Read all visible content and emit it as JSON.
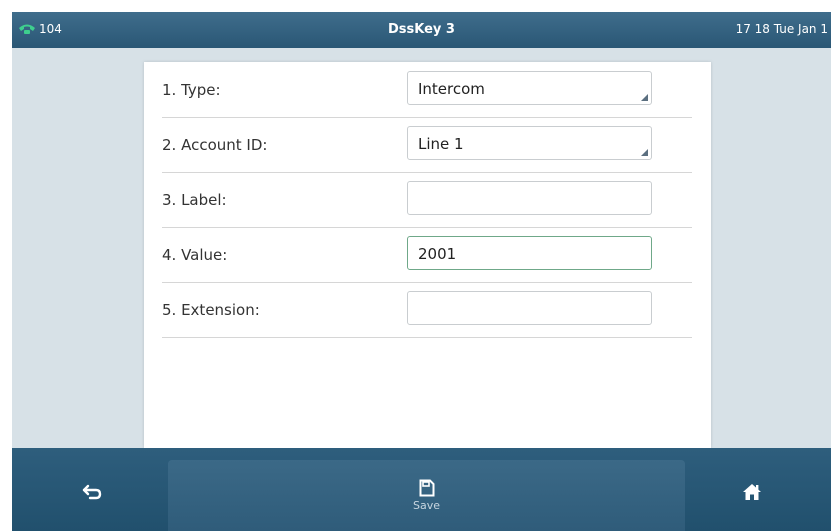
{
  "status": {
    "line_number": "104",
    "title": "DssKey 3",
    "datetime": "17 18 Tue Jan 1"
  },
  "form": {
    "rows": [
      {
        "label": "1. Type:",
        "value": "Intercom",
        "kind": "dropdown"
      },
      {
        "label": "2. Account ID:",
        "value": "Line 1",
        "kind": "dropdown"
      },
      {
        "label": "3. Label:",
        "value": "",
        "kind": "text"
      },
      {
        "label": "4. Value:",
        "value": "2001",
        "kind": "text",
        "focused": true
      },
      {
        "label": "5. Extension:",
        "value": "",
        "kind": "text"
      }
    ]
  },
  "toolbar": {
    "back_icon": "back-arrow-icon",
    "save_icon": "save-icon",
    "save_label": "Save",
    "home_icon": "home-icon"
  },
  "colors": {
    "header": "#2c5a78",
    "content_bg": "#d7e1e7",
    "focus_border": "#6fa889",
    "phone_icon": "#3ecf8e"
  }
}
